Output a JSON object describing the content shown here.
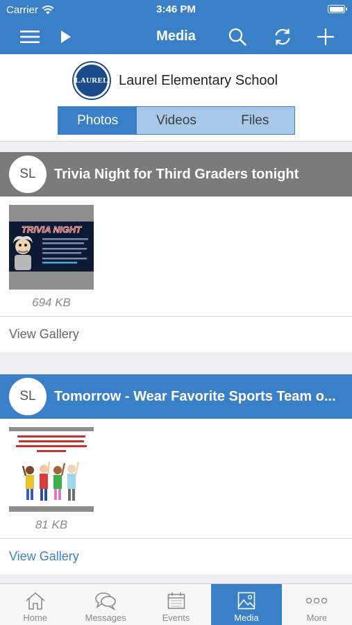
{
  "status_bar": {
    "carrier": "Carrier",
    "time": "3:46 PM"
  },
  "nav": {
    "title": "Media"
  },
  "school": {
    "name": "Laurel Elementary School",
    "logo_text": "LAUREL"
  },
  "segments": [
    {
      "label": "Photos",
      "active": true
    },
    {
      "label": "Videos",
      "active": false
    },
    {
      "label": "Files",
      "active": false
    }
  ],
  "posts": [
    {
      "avatar": "SL",
      "title": "Trivia Night for Third Graders tonight",
      "header_color": "#7b7b7b",
      "file_size": "694 KB",
      "footer_link": "View Gallery",
      "footer_color": "#666666"
    },
    {
      "avatar": "SL",
      "title": "Tomorrow - Wear Favorite Sports Team o...",
      "header_color": "#3a80c9",
      "file_size": "81 KB",
      "footer_link": "View Gallery",
      "footer_color": "#3a80c9"
    }
  ],
  "tabs": [
    {
      "label": "Home",
      "icon": "home-icon",
      "active": false
    },
    {
      "label": "Messages",
      "icon": "messages-icon",
      "active": false
    },
    {
      "label": "Events",
      "icon": "calendar-icon",
      "active": false
    },
    {
      "label": "Media",
      "icon": "image-icon",
      "active": true
    },
    {
      "label": "More",
      "icon": "more-icon",
      "active": false
    }
  ],
  "colors": {
    "accent": "#3a80c9",
    "accent_light": "#a8c8ea",
    "post_header_gray": "#7b7b7b"
  }
}
